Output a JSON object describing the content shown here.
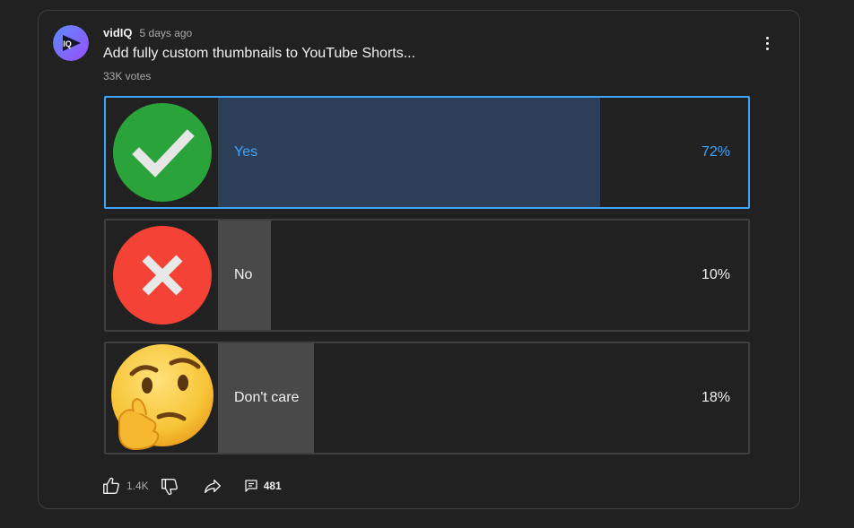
{
  "post": {
    "channel_name": "vidIQ",
    "time_ago": "5 days ago",
    "avatar_text": "IQ",
    "title": "Add fully custom thumbnails to YouTube Shorts...",
    "votes": "33K votes"
  },
  "poll": {
    "options": [
      {
        "label": "Yes",
        "percent": "72%",
        "share": 0.72,
        "selected": true,
        "image": "check-mark-icon",
        "image_color": "#2aa33b"
      },
      {
        "label": "No",
        "percent": "10%",
        "share": 0.1,
        "selected": false,
        "image": "cross-mark-icon",
        "image_color": "#f44336"
      },
      {
        "label": "Don't care",
        "percent": "18%",
        "share": 0.18,
        "selected": false,
        "image": "thinking-face-icon",
        "image_color": "#f9c22e"
      }
    ]
  },
  "actions": {
    "like_count": "1.4K",
    "comment_count": "481"
  },
  "colors": {
    "background": "#212121",
    "accent": "#3ea6ff",
    "selected_fill": "#2d3e59",
    "fill": "#494949",
    "border": "#3f3f3f"
  }
}
